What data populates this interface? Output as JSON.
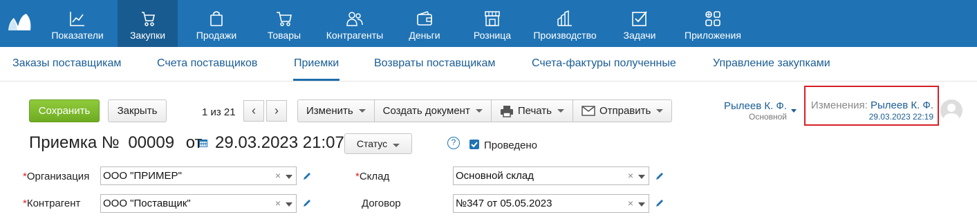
{
  "nav": {
    "items": [
      {
        "label": "Показатели",
        "icon": "chart-line-icon"
      },
      {
        "label": "Закупки",
        "icon": "cart-hand-icon"
      },
      {
        "label": "Продажи",
        "icon": "shopping-bag-icon"
      },
      {
        "label": "Товары",
        "icon": "cart-icon"
      },
      {
        "label": "Контрагенты",
        "icon": "users-icon"
      },
      {
        "label": "Деньги",
        "icon": "wallet-icon"
      },
      {
        "label": "Розница",
        "icon": "store-icon"
      },
      {
        "label": "Производство",
        "icon": "factory-icon"
      },
      {
        "label": "Задачи",
        "icon": "checkbox-icon"
      },
      {
        "label": "Приложения",
        "icon": "apps-icon"
      }
    ]
  },
  "subnav": {
    "items": [
      "Заказы поставщикам",
      "Счета поставщиков",
      "Приемки",
      "Возвраты поставщикам",
      "Счета-фактуры полученные",
      "Управление закупками"
    ]
  },
  "toolbar": {
    "save": "Сохранить",
    "close": "Закрыть",
    "pager": "1 из 21",
    "edit": "Изменить",
    "create_doc": "Создать документ",
    "print": "Печать",
    "send": "Отправить"
  },
  "header": {
    "title_prefix": "Приемка №",
    "number": "00009",
    "from": "от",
    "datetime": "29.03.2023 21:07",
    "status": "Статус",
    "help": "?",
    "posted_label": "Проведено",
    "posted": true
  },
  "form": {
    "org_label": "Организация",
    "org_value": "ООО \"ПРИМЕР\"",
    "contractor_label": "Контрагент",
    "contractor_value": "ООО \"Поставщик\"",
    "warehouse_label": "Склад",
    "warehouse_value": "Основной склад",
    "contract_label": "Договор",
    "contract_value": "№347 от 05.05.2023",
    "required_mark": "*",
    "clear_mark": "×"
  },
  "user": {
    "name": "Рылеев К. Ф.",
    "role": "Основной"
  },
  "changes": {
    "label": "Изменения:",
    "author": "Рылеев К. Ф.",
    "datetime": "29.03.2023 22:19"
  },
  "colors": {
    "topbar": "#1f73b4",
    "active_nav": "#185b90",
    "link": "#1a5d95",
    "save": "#7ab82b",
    "highlight": "#d62027"
  }
}
